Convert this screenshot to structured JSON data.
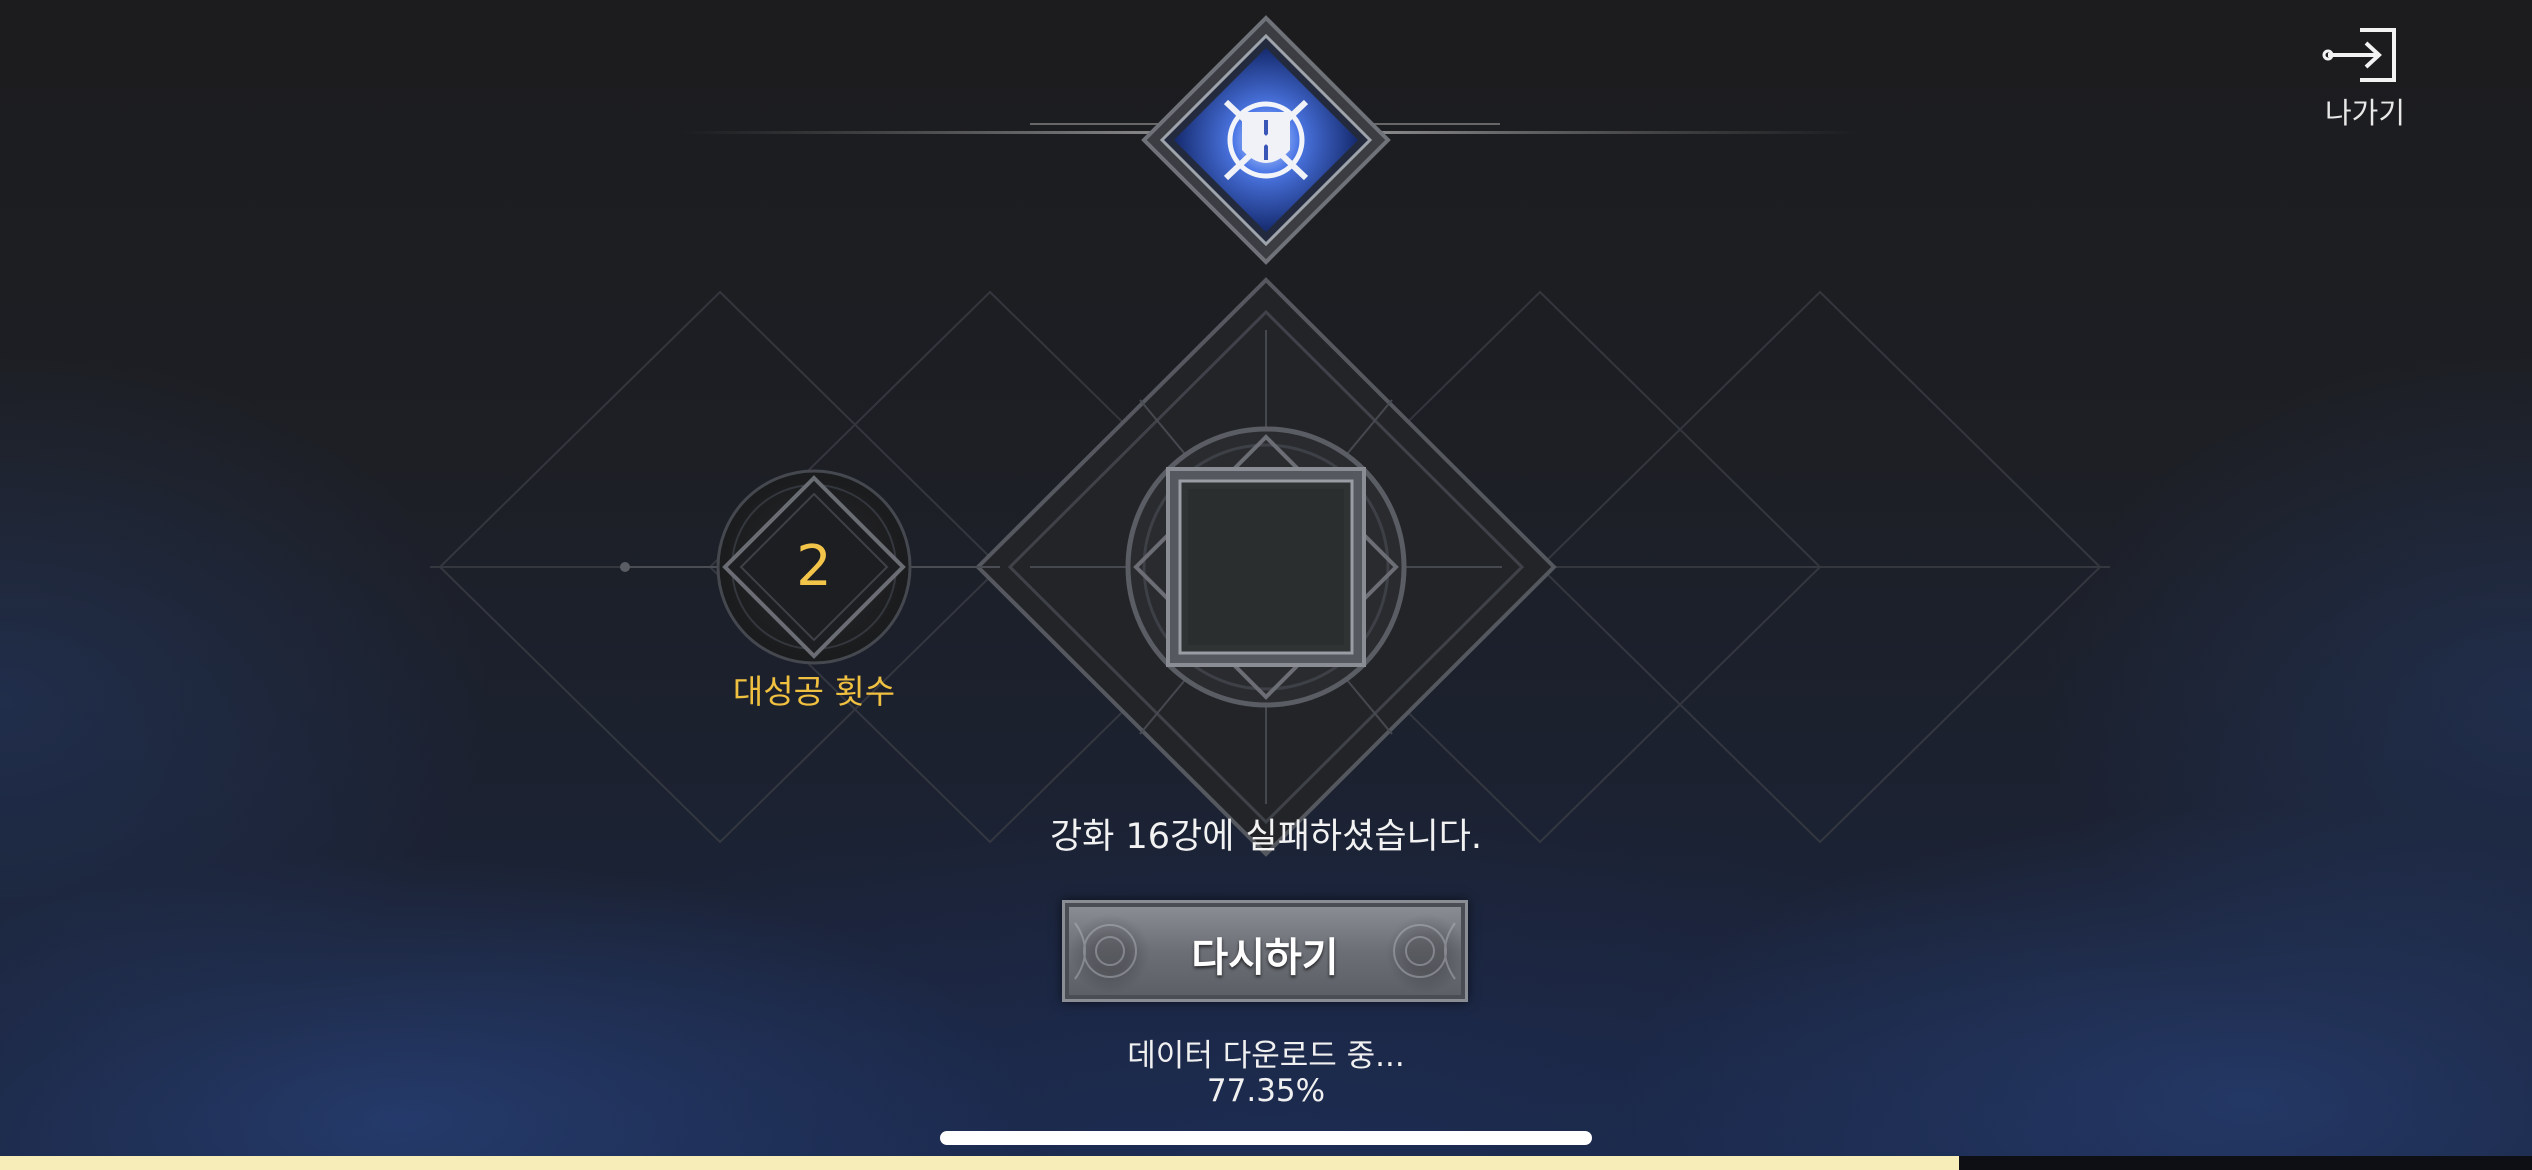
{
  "exit": {
    "label": "나가기",
    "icon": "exit-door-icon"
  },
  "emblem": {
    "icon": "shield-crossed-swords-emblem-icon",
    "accent_color": "#3a63d8"
  },
  "counter": {
    "value": "2",
    "label": "대성공 횟수",
    "color": "#f3c44a"
  },
  "item_slot": {
    "state": "empty"
  },
  "result": {
    "message": "강화 16강에 실패하셨습니다."
  },
  "retry": {
    "label": "다시하기"
  },
  "download": {
    "status": "데이터 다운로드 중...",
    "percent_text": "77.35%",
    "progress": 0.7735,
    "fill_color": "#f7edb8"
  }
}
